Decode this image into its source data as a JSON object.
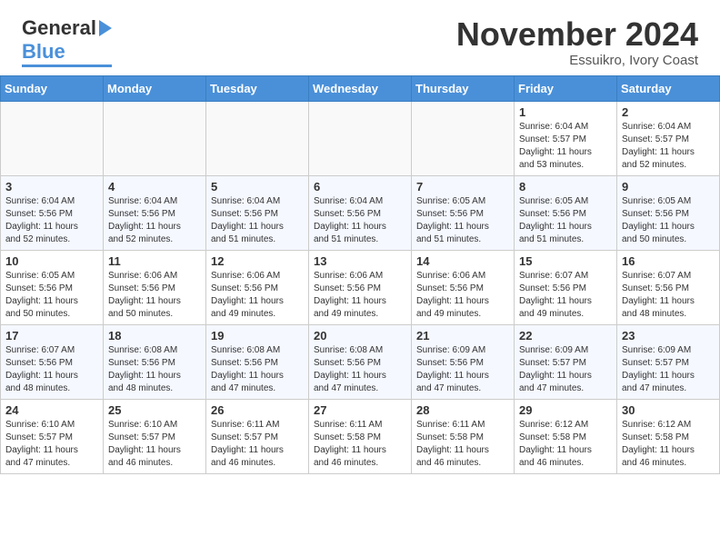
{
  "header": {
    "month": "November 2024",
    "location": "Essuikro, Ivory Coast",
    "logo_general": "General",
    "logo_blue": "Blue"
  },
  "weekdays": [
    "Sunday",
    "Monday",
    "Tuesday",
    "Wednesday",
    "Thursday",
    "Friday",
    "Saturday"
  ],
  "weeks": [
    [
      {
        "day": "",
        "info": ""
      },
      {
        "day": "",
        "info": ""
      },
      {
        "day": "",
        "info": ""
      },
      {
        "day": "",
        "info": ""
      },
      {
        "day": "",
        "info": ""
      },
      {
        "day": "1",
        "info": "Sunrise: 6:04 AM\nSunset: 5:57 PM\nDaylight: 11 hours\nand 53 minutes."
      },
      {
        "day": "2",
        "info": "Sunrise: 6:04 AM\nSunset: 5:57 PM\nDaylight: 11 hours\nand 52 minutes."
      }
    ],
    [
      {
        "day": "3",
        "info": "Sunrise: 6:04 AM\nSunset: 5:56 PM\nDaylight: 11 hours\nand 52 minutes."
      },
      {
        "day": "4",
        "info": "Sunrise: 6:04 AM\nSunset: 5:56 PM\nDaylight: 11 hours\nand 52 minutes."
      },
      {
        "day": "5",
        "info": "Sunrise: 6:04 AM\nSunset: 5:56 PM\nDaylight: 11 hours\nand 51 minutes."
      },
      {
        "day": "6",
        "info": "Sunrise: 6:04 AM\nSunset: 5:56 PM\nDaylight: 11 hours\nand 51 minutes."
      },
      {
        "day": "7",
        "info": "Sunrise: 6:05 AM\nSunset: 5:56 PM\nDaylight: 11 hours\nand 51 minutes."
      },
      {
        "day": "8",
        "info": "Sunrise: 6:05 AM\nSunset: 5:56 PM\nDaylight: 11 hours\nand 51 minutes."
      },
      {
        "day": "9",
        "info": "Sunrise: 6:05 AM\nSunset: 5:56 PM\nDaylight: 11 hours\nand 50 minutes."
      }
    ],
    [
      {
        "day": "10",
        "info": "Sunrise: 6:05 AM\nSunset: 5:56 PM\nDaylight: 11 hours\nand 50 minutes."
      },
      {
        "day": "11",
        "info": "Sunrise: 6:06 AM\nSunset: 5:56 PM\nDaylight: 11 hours\nand 50 minutes."
      },
      {
        "day": "12",
        "info": "Sunrise: 6:06 AM\nSunset: 5:56 PM\nDaylight: 11 hours\nand 49 minutes."
      },
      {
        "day": "13",
        "info": "Sunrise: 6:06 AM\nSunset: 5:56 PM\nDaylight: 11 hours\nand 49 minutes."
      },
      {
        "day": "14",
        "info": "Sunrise: 6:06 AM\nSunset: 5:56 PM\nDaylight: 11 hours\nand 49 minutes."
      },
      {
        "day": "15",
        "info": "Sunrise: 6:07 AM\nSunset: 5:56 PM\nDaylight: 11 hours\nand 49 minutes."
      },
      {
        "day": "16",
        "info": "Sunrise: 6:07 AM\nSunset: 5:56 PM\nDaylight: 11 hours\nand 48 minutes."
      }
    ],
    [
      {
        "day": "17",
        "info": "Sunrise: 6:07 AM\nSunset: 5:56 PM\nDaylight: 11 hours\nand 48 minutes."
      },
      {
        "day": "18",
        "info": "Sunrise: 6:08 AM\nSunset: 5:56 PM\nDaylight: 11 hours\nand 48 minutes."
      },
      {
        "day": "19",
        "info": "Sunrise: 6:08 AM\nSunset: 5:56 PM\nDaylight: 11 hours\nand 47 minutes."
      },
      {
        "day": "20",
        "info": "Sunrise: 6:08 AM\nSunset: 5:56 PM\nDaylight: 11 hours\nand 47 minutes."
      },
      {
        "day": "21",
        "info": "Sunrise: 6:09 AM\nSunset: 5:56 PM\nDaylight: 11 hours\nand 47 minutes."
      },
      {
        "day": "22",
        "info": "Sunrise: 6:09 AM\nSunset: 5:57 PM\nDaylight: 11 hours\nand 47 minutes."
      },
      {
        "day": "23",
        "info": "Sunrise: 6:09 AM\nSunset: 5:57 PM\nDaylight: 11 hours\nand 47 minutes."
      }
    ],
    [
      {
        "day": "24",
        "info": "Sunrise: 6:10 AM\nSunset: 5:57 PM\nDaylight: 11 hours\nand 47 minutes."
      },
      {
        "day": "25",
        "info": "Sunrise: 6:10 AM\nSunset: 5:57 PM\nDaylight: 11 hours\nand 46 minutes."
      },
      {
        "day": "26",
        "info": "Sunrise: 6:11 AM\nSunset: 5:57 PM\nDaylight: 11 hours\nand 46 minutes."
      },
      {
        "day": "27",
        "info": "Sunrise: 6:11 AM\nSunset: 5:58 PM\nDaylight: 11 hours\nand 46 minutes."
      },
      {
        "day": "28",
        "info": "Sunrise: 6:11 AM\nSunset: 5:58 PM\nDaylight: 11 hours\nand 46 minutes."
      },
      {
        "day": "29",
        "info": "Sunrise: 6:12 AM\nSunset: 5:58 PM\nDaylight: 11 hours\nand 46 minutes."
      },
      {
        "day": "30",
        "info": "Sunrise: 6:12 AM\nSunset: 5:58 PM\nDaylight: 11 hours\nand 46 minutes."
      }
    ]
  ]
}
